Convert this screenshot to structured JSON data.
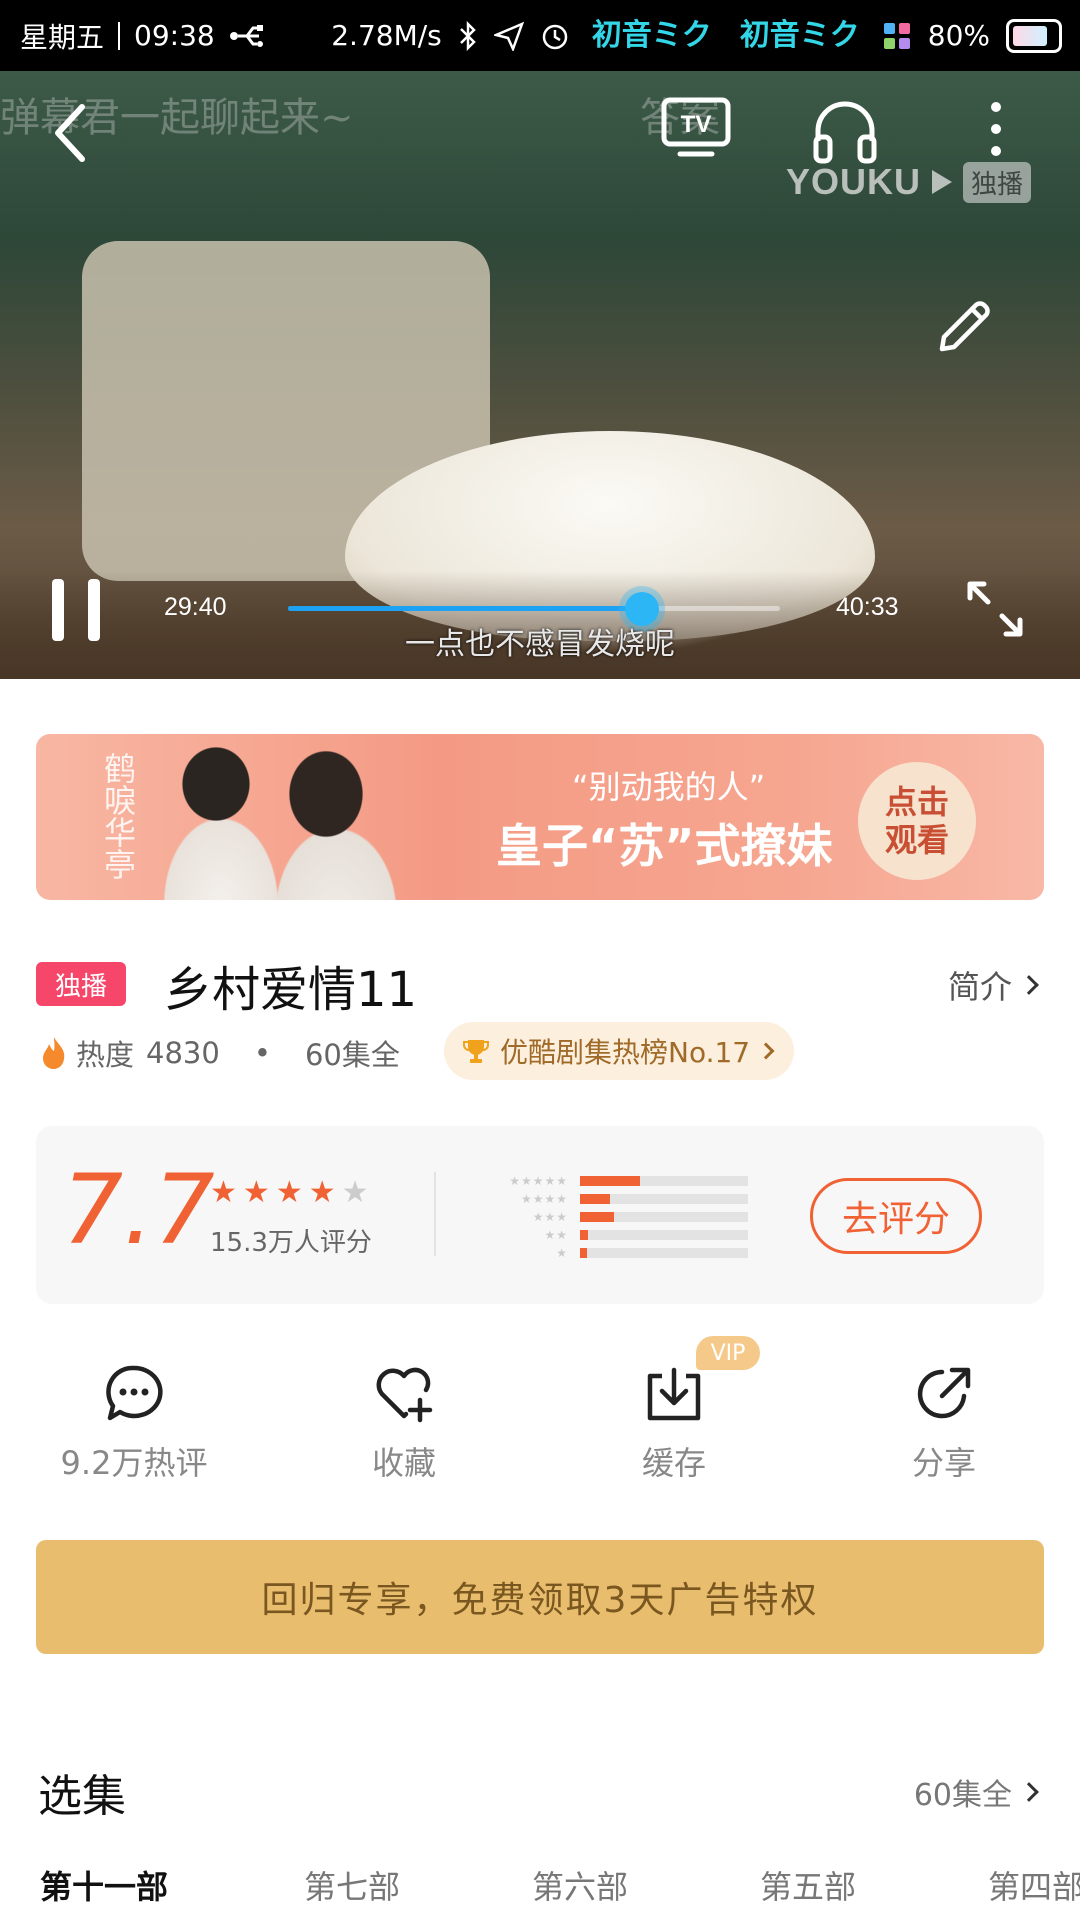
{
  "status_bar": {
    "day": "星期五",
    "time": "09:38",
    "net_speed": "2.78M/s",
    "app_badge_1": "初音ミク",
    "app_badge_2": "初音ミク",
    "battery": "80%"
  },
  "player": {
    "danmaku_1": "弹幕君一起聊起来~",
    "danmaku_2": "答案",
    "watermark": "YOUKU",
    "watermark_badge": "独播",
    "current_time": "29:40",
    "total_time": "40:33",
    "progress_percent": 72,
    "subtitle": "一点也不感冒发烧呢"
  },
  "promo": {
    "logo_text": "鹤唳华亭",
    "quote": "“别动我的人”",
    "headline": "皇子“苏”式撩妹",
    "cta": "点击观看"
  },
  "show": {
    "exclusive_tag": "独播",
    "title": "乡村爱情11",
    "intro_link": "简介",
    "heat_label": "热度",
    "heat_value": "4830",
    "dot": "•",
    "episodes_total": "60集全",
    "rank_badge": "优酷剧集热榜No.17"
  },
  "rating": {
    "score": "7.7",
    "stars_filled": 4,
    "stars_total": 5,
    "count_label": "15.3万人评分",
    "distribution": [
      0.36,
      0.18,
      0.2,
      0.05,
      0.04
    ],
    "rate_button": "去评分"
  },
  "actions": {
    "comments": "9.2万热评",
    "favorite": "收藏",
    "download": "缓存",
    "download_badge": "VIP",
    "share": "分享"
  },
  "privilege_banner": "回归专享，免费领取3天广告特权",
  "episodes": {
    "title": "选集",
    "all_label": "60集全",
    "seasons": [
      "第十一部",
      "第七部",
      "第六部",
      "第五部",
      "第四部"
    ],
    "active_index": 0
  },
  "colors": {
    "accent_orange": "#f06234",
    "exclusive_pink": "#f6466a",
    "progress_blue": "#1da1f2",
    "privilege_gold": "#e8bd6d"
  }
}
